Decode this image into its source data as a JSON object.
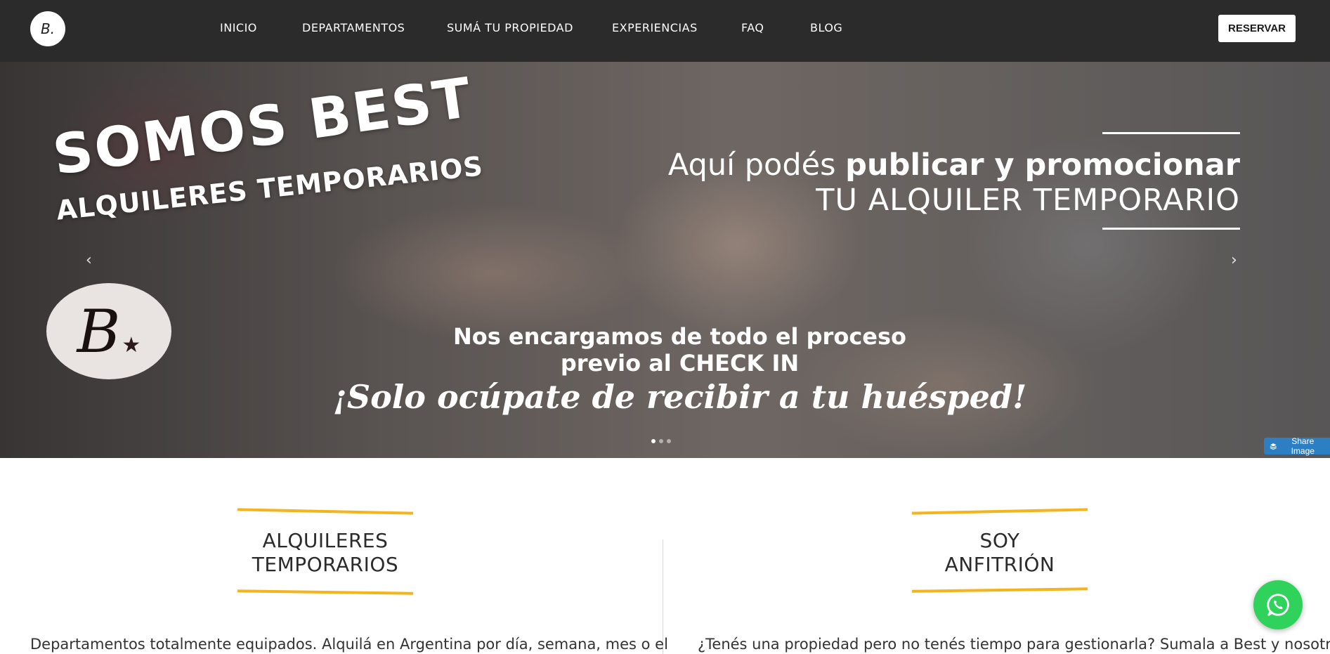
{
  "header": {
    "logo_text": "B.",
    "nav": [
      "INICIO",
      "DEPARTAMENTOS",
      "SUMÁ TU PROPIEDAD",
      "EXPERIENCIAS",
      "FAQ",
      "BLOG"
    ],
    "reserve_label": "RESERVAR"
  },
  "hero": {
    "brand_title": "SOMOS BEST",
    "brand_subtitle": "ALQUILERES TEMPORARIOS",
    "badge_letter": "B",
    "promo_prefix": "Aquí podés ",
    "promo_bold": "publicar y promocionar",
    "promo_line2": "TU ALQUILER TEMPORARIO",
    "process_line1": "Nos encargamos de todo el proceso",
    "process_line2": "previo al CHECK IN",
    "tagline": "¡Solo ocúpate de recibir a tu huésped!",
    "prev_arrow": "‹",
    "next_arrow": "›",
    "slide_count": 3,
    "active_slide": 1,
    "share_label": "Share Image"
  },
  "sections": {
    "left": {
      "title_line1": "ALQUILERES",
      "title_line2": "TEMPORARIOS",
      "text": "Departamentos totalmente equipados. Alquilá en Argentina por día, semana, mes o el"
    },
    "right": {
      "title_line1": "SOY",
      "title_line2": "ANFITRIÓN",
      "text": "¿Tenés una propiedad pero no tenés tiempo para gestionarla? Sumala a Best y nosotros"
    }
  },
  "colors": {
    "nav_bg": "#2b2b2b",
    "accent_yellow": "#f3b41c",
    "whatsapp_green": "#2fd25a",
    "share_blue": "#2b7fc2"
  },
  "icons": {
    "whatsapp": "whatsapp-icon",
    "share": "layers-icon",
    "star": "star-icon"
  }
}
